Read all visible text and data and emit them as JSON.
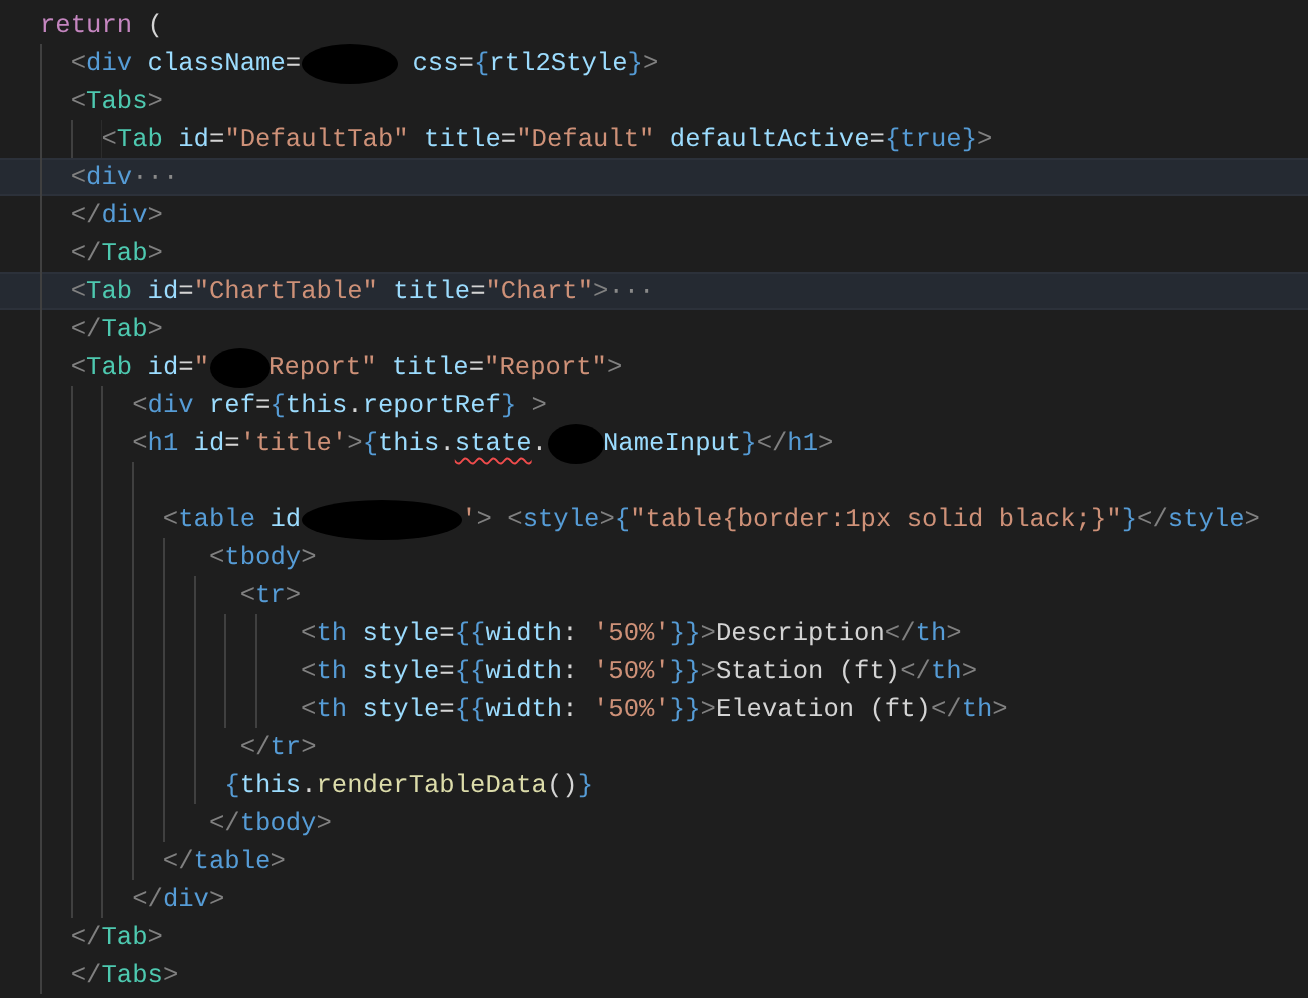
{
  "editor": {
    "lines": [
      {
        "current": false,
        "tokens": [
          {
            "kind": "keyword",
            "text": "return"
          },
          {
            "kind": "text",
            "text": " ("
          }
        ]
      },
      {
        "current": false,
        "tokens": [
          {
            "kind": "punct",
            "text": "  <"
          },
          {
            "kind": "tag",
            "text": "div"
          },
          {
            "kind": "attr",
            "text": " className"
          },
          {
            "kind": "op",
            "text": "="
          },
          {
            "kind": "redacted"
          },
          {
            "kind": "attr",
            "text": " css"
          },
          {
            "kind": "op",
            "text": "="
          },
          {
            "kind": "brace",
            "text": "{"
          },
          {
            "kind": "attr",
            "text": "rtl2Style"
          },
          {
            "kind": "brace",
            "text": "}"
          },
          {
            "kind": "punct",
            "text": ">"
          }
        ]
      },
      {
        "current": false,
        "tokens": [
          {
            "kind": "punct",
            "text": "  <"
          },
          {
            "kind": "component",
            "text": "Tabs"
          },
          {
            "kind": "punct",
            "text": ">"
          }
        ]
      },
      {
        "current": false,
        "tokens": [
          {
            "kind": "punct",
            "text": "    <"
          },
          {
            "kind": "component",
            "text": "Tab"
          },
          {
            "kind": "attr",
            "text": " id"
          },
          {
            "kind": "op",
            "text": "="
          },
          {
            "kind": "string",
            "text": "\"DefaultTab\""
          },
          {
            "kind": "attr",
            "text": " title"
          },
          {
            "kind": "op",
            "text": "="
          },
          {
            "kind": "string",
            "text": "\"Default\""
          },
          {
            "kind": "attr",
            "text": " defaultActive"
          },
          {
            "kind": "op",
            "text": "="
          },
          {
            "kind": "brace",
            "text": "{"
          },
          {
            "kind": "const",
            "text": "true"
          },
          {
            "kind": "brace",
            "text": "}"
          },
          {
            "kind": "punct",
            "text": ">"
          }
        ]
      },
      {
        "current": true,
        "tokens": [
          {
            "kind": "punct",
            "text": "  <"
          },
          {
            "kind": "tag",
            "text": "div"
          },
          {
            "kind": "fold",
            "text": "···"
          }
        ]
      },
      {
        "current": false,
        "tokens": [
          {
            "kind": "punct",
            "text": "  </"
          },
          {
            "kind": "tag",
            "text": "div"
          },
          {
            "kind": "punct",
            "text": ">"
          }
        ]
      },
      {
        "current": false,
        "tokens": [
          {
            "kind": "punct",
            "text": "  </"
          },
          {
            "kind": "component",
            "text": "Tab"
          },
          {
            "kind": "punct",
            "text": ">"
          }
        ]
      },
      {
        "current": true,
        "tokens": [
          {
            "kind": "punct",
            "text": "  <"
          },
          {
            "kind": "component",
            "text": "Tab"
          },
          {
            "kind": "attr",
            "text": " id"
          },
          {
            "kind": "op",
            "text": "="
          },
          {
            "kind": "string",
            "text": "\"ChartTable\""
          },
          {
            "kind": "attr",
            "text": " title"
          },
          {
            "kind": "op",
            "text": "="
          },
          {
            "kind": "string",
            "text": "\"Chart\""
          },
          {
            "kind": "punct",
            "text": ">"
          },
          {
            "kind": "fold",
            "text": "···"
          }
        ]
      },
      {
        "current": false,
        "tokens": [
          {
            "kind": "punct",
            "text": "  </"
          },
          {
            "kind": "component",
            "text": "Tab"
          },
          {
            "kind": "punct",
            "text": ">"
          }
        ]
      },
      {
        "current": false,
        "tokens": [
          {
            "kind": "punct",
            "text": "  <"
          },
          {
            "kind": "component",
            "text": "Tab"
          },
          {
            "kind": "attr",
            "text": " id"
          },
          {
            "kind": "op",
            "text": "="
          },
          {
            "kind": "string",
            "text": "\""
          },
          {
            "kind": "redacted"
          },
          {
            "kind": "string",
            "text": "Report\""
          },
          {
            "kind": "attr",
            "text": " title"
          },
          {
            "kind": "op",
            "text": "="
          },
          {
            "kind": "string",
            "text": "\"Report\""
          },
          {
            "kind": "punct",
            "text": ">"
          }
        ]
      },
      {
        "current": false,
        "tokens": [
          {
            "kind": "punct",
            "text": "      <"
          },
          {
            "kind": "tag",
            "text": "div"
          },
          {
            "kind": "attr",
            "text": " ref"
          },
          {
            "kind": "op",
            "text": "="
          },
          {
            "kind": "brace",
            "text": "{"
          },
          {
            "kind": "var",
            "text": "this"
          },
          {
            "kind": "text",
            "text": "."
          },
          {
            "kind": "var",
            "text": "reportRef"
          },
          {
            "kind": "brace",
            "text": "}"
          },
          {
            "kind": "punct",
            "text": " >"
          }
        ]
      },
      {
        "current": false,
        "tokens": [
          {
            "kind": "punct",
            "text": "      <"
          },
          {
            "kind": "tag",
            "text": "h1"
          },
          {
            "kind": "attr",
            "text": " id"
          },
          {
            "kind": "op",
            "text": "="
          },
          {
            "kind": "string",
            "text": "'title'"
          },
          {
            "kind": "punct",
            "text": ">"
          },
          {
            "kind": "brace",
            "text": "{"
          },
          {
            "kind": "var",
            "text": "this"
          },
          {
            "kind": "text",
            "text": "."
          },
          {
            "kind": "error",
            "text": "state"
          },
          {
            "kind": "text",
            "text": "."
          },
          {
            "kind": "redacted"
          },
          {
            "kind": "var",
            "text": "NameInput"
          },
          {
            "kind": "brace",
            "text": "}"
          },
          {
            "kind": "punct",
            "text": "</"
          },
          {
            "kind": "tag",
            "text": "h1"
          },
          {
            "kind": "punct",
            "text": ">"
          }
        ]
      },
      {
        "current": false
      },
      {
        "current": false,
        "tokens": [
          {
            "kind": "punct",
            "text": "        <"
          },
          {
            "kind": "tag",
            "text": "table"
          },
          {
            "kind": "attr",
            "text": " id"
          },
          {
            "kind": "redacted"
          },
          {
            "kind": "string",
            "text": "'"
          },
          {
            "kind": "punct",
            "text": ">"
          },
          {
            "kind": "punct",
            "text": " <"
          },
          {
            "kind": "tag",
            "text": "style"
          },
          {
            "kind": "punct",
            "text": ">"
          },
          {
            "kind": "brace",
            "text": "{"
          },
          {
            "kind": "string",
            "text": "\"table{border:1px solid black;}\""
          },
          {
            "kind": "brace",
            "text": "}"
          },
          {
            "kind": "punct",
            "text": "</"
          },
          {
            "kind": "tag",
            "text": "style"
          },
          {
            "kind": "punct",
            "text": ">"
          }
        ]
      },
      {
        "current": false,
        "tokens": [
          {
            "kind": "punct",
            "text": "           <"
          },
          {
            "kind": "tag",
            "text": "tbody"
          },
          {
            "kind": "punct",
            "text": ">"
          }
        ]
      },
      {
        "current": false,
        "tokens": [
          {
            "kind": "punct",
            "text": "             <"
          },
          {
            "kind": "tag",
            "text": "tr"
          },
          {
            "kind": "punct",
            "text": ">"
          }
        ]
      },
      {
        "current": false,
        "tokens": [
          {
            "kind": "punct",
            "text": "                 <"
          },
          {
            "kind": "tag",
            "text": "th"
          },
          {
            "kind": "attr",
            "text": " style"
          },
          {
            "kind": "op",
            "text": "="
          },
          {
            "kind": "brace",
            "text": "{{"
          },
          {
            "kind": "attr",
            "text": "width"
          },
          {
            "kind": "text",
            "text": ": "
          },
          {
            "kind": "string",
            "text": "'50%'"
          },
          {
            "kind": "brace",
            "text": "}}"
          },
          {
            "kind": "punct",
            "text": ">"
          },
          {
            "kind": "text",
            "text": "Description"
          },
          {
            "kind": "punct",
            "text": "</"
          },
          {
            "kind": "tag",
            "text": "th"
          },
          {
            "kind": "punct",
            "text": ">"
          }
        ]
      },
      {
        "current": false,
        "tokens": [
          {
            "kind": "punct",
            "text": "                 <"
          },
          {
            "kind": "tag",
            "text": "th"
          },
          {
            "kind": "attr",
            "text": " style"
          },
          {
            "kind": "op",
            "text": "="
          },
          {
            "kind": "brace",
            "text": "{{"
          },
          {
            "kind": "attr",
            "text": "width"
          },
          {
            "kind": "text",
            "text": ": "
          },
          {
            "kind": "string",
            "text": "'50%'"
          },
          {
            "kind": "brace",
            "text": "}}"
          },
          {
            "kind": "punct",
            "text": ">"
          },
          {
            "kind": "text",
            "text": "Station (ft)"
          },
          {
            "kind": "punct",
            "text": "</"
          },
          {
            "kind": "tag",
            "text": "th"
          },
          {
            "kind": "punct",
            "text": ">"
          }
        ]
      },
      {
        "current": false,
        "tokens": [
          {
            "kind": "punct",
            "text": "                 <"
          },
          {
            "kind": "tag",
            "text": "th"
          },
          {
            "kind": "attr",
            "text": " style"
          },
          {
            "kind": "op",
            "text": "="
          },
          {
            "kind": "brace",
            "text": "{{"
          },
          {
            "kind": "attr",
            "text": "width"
          },
          {
            "kind": "text",
            "text": ": "
          },
          {
            "kind": "string",
            "text": "'50%'"
          },
          {
            "kind": "brace",
            "text": "}}"
          },
          {
            "kind": "punct",
            "text": ">"
          },
          {
            "kind": "text",
            "text": "Elevation (ft)"
          },
          {
            "kind": "punct",
            "text": "</"
          },
          {
            "kind": "tag",
            "text": "th"
          },
          {
            "kind": "punct",
            "text": ">"
          }
        ]
      },
      {
        "current": false,
        "tokens": [
          {
            "kind": "punct",
            "text": "             </"
          },
          {
            "kind": "tag",
            "text": "tr"
          },
          {
            "kind": "punct",
            "text": ">"
          }
        ]
      },
      {
        "current": false,
        "tokens": [
          {
            "kind": "brace",
            "text": "            {"
          },
          {
            "kind": "var",
            "text": "this"
          },
          {
            "kind": "text",
            "text": "."
          },
          {
            "kind": "func",
            "text": "renderTableData"
          },
          {
            "kind": "text",
            "text": "()"
          },
          {
            "kind": "brace",
            "text": "}"
          }
        ]
      },
      {
        "current": false,
        "tokens": [
          {
            "kind": "punct",
            "text": "           </"
          },
          {
            "kind": "tag",
            "text": "tbody"
          },
          {
            "kind": "punct",
            "text": ">"
          }
        ]
      },
      {
        "current": false,
        "tokens": [
          {
            "kind": "punct",
            "text": "        </"
          },
          {
            "kind": "tag",
            "text": "table"
          },
          {
            "kind": "punct",
            "text": ">"
          }
        ]
      },
      {
        "current": false,
        "tokens": [
          {
            "kind": "punct",
            "text": "      </"
          },
          {
            "kind": "tag",
            "text": "div"
          },
          {
            "kind": "punct",
            "text": ">"
          }
        ]
      },
      {
        "current": false,
        "tokens": [
          {
            "kind": "punct",
            "text": "  </"
          },
          {
            "kind": "component",
            "text": "Tab"
          },
          {
            "kind": "punct",
            "text": ">"
          }
        ]
      },
      {
        "current": false,
        "tokens": [
          {
            "kind": "punct",
            "text": "  </"
          },
          {
            "kind": "component",
            "text": "Tabs"
          },
          {
            "kind": "punct",
            "text": ">"
          }
        ]
      }
    ]
  }
}
